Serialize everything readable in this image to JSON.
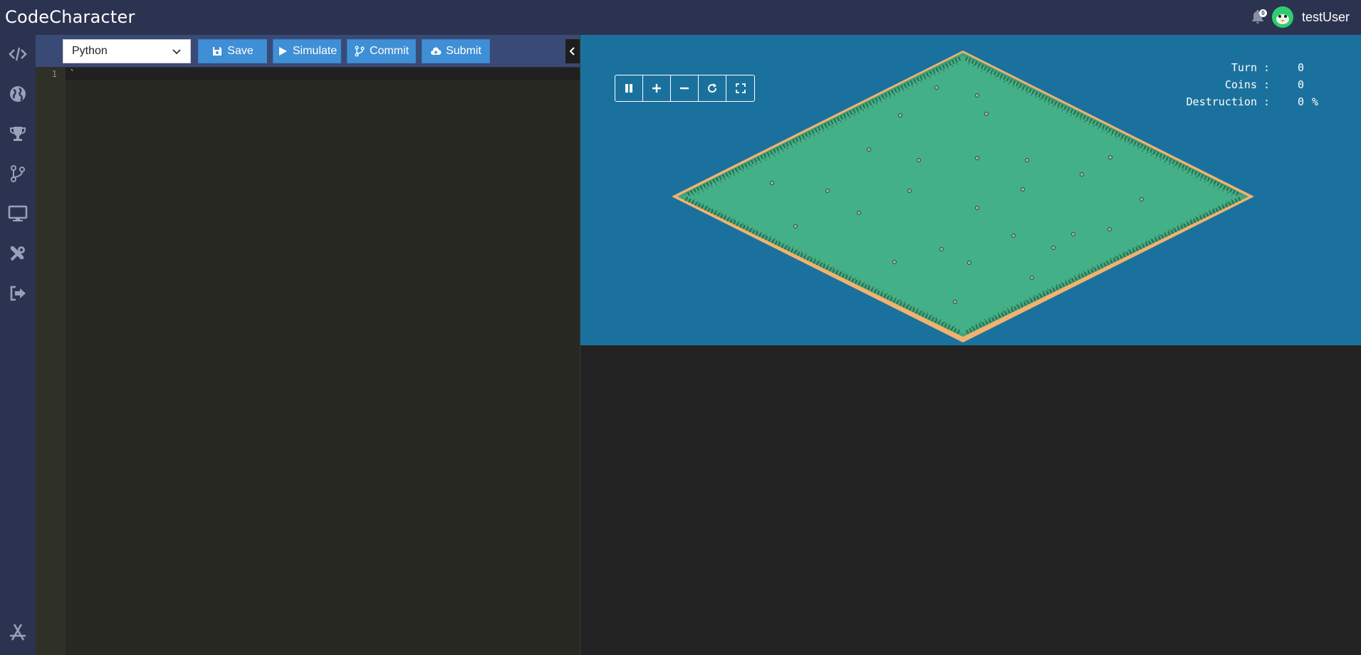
{
  "app": {
    "title": "CodeCharacter"
  },
  "header": {
    "username": "testUser",
    "notification_count": "0"
  },
  "sidebar": {
    "items": [
      {
        "name": "code",
        "icon": "code-icon"
      },
      {
        "name": "globe",
        "icon": "globe-icon"
      },
      {
        "name": "leaderboard",
        "icon": "trophy-icon"
      },
      {
        "name": "commits",
        "icon": "branch-icon"
      },
      {
        "name": "matches",
        "icon": "monitor-icon"
      },
      {
        "name": "tools",
        "icon": "tools-icon"
      },
      {
        "name": "logout",
        "icon": "signout-icon"
      }
    ],
    "bottom_icon": "app-store-icon"
  },
  "toolbar": {
    "language": "Python",
    "save_label": "Save",
    "simulate_label": "Simulate",
    "commit_label": "Commit",
    "submit_label": "Submit"
  },
  "editor": {
    "line_numbers": [
      "1"
    ],
    "lines": [
      "`"
    ]
  },
  "game": {
    "stats": [
      {
        "label": "Turn",
        "value": "0",
        "unit": ""
      },
      {
        "label": "Coins",
        "value": "0",
        "unit": ""
      },
      {
        "label": "Destruction",
        "value": "0",
        "unit": "%"
      }
    ]
  },
  "colors": {
    "nav_bg": "#2c3350",
    "toolbar_bg": "#3a4a77",
    "button_blue": "#3f8fd6",
    "editor_bg": "#272822",
    "game_bg": "#1b719d",
    "grass": "#44b087",
    "map_border": "#f2b26f"
  }
}
